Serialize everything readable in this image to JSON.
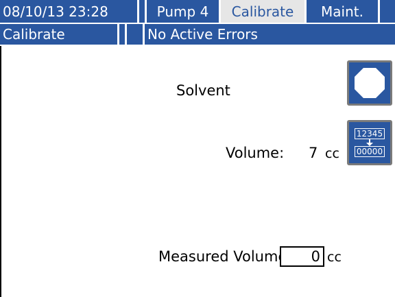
{
  "header": {
    "datetime": "08/10/13 23:28",
    "tabs": [
      {
        "label": "Pump 4",
        "active": false
      },
      {
        "label": "Calibrate",
        "active": true
      },
      {
        "label": "Maint.",
        "active": false
      }
    ]
  },
  "status_bar": {
    "screen_name": "Calibrate",
    "error_message": "No Active Errors"
  },
  "main": {
    "material_label": "Solvent",
    "volume_label": "Volume:",
    "volume_value": "7",
    "volume_unit": "cc",
    "measured_label": "Measured Volume:",
    "measured_value": "0",
    "measured_unit": "cc",
    "reset_icon_top": "12345",
    "reset_icon_bottom": "00000"
  },
  "colors": {
    "bar_blue": "#2a57a0",
    "active_tab_bg": "#e6e6e6",
    "button_border": "#7a7a7a"
  },
  "icons": [
    "stop-icon",
    "reset-counter-icon"
  ]
}
